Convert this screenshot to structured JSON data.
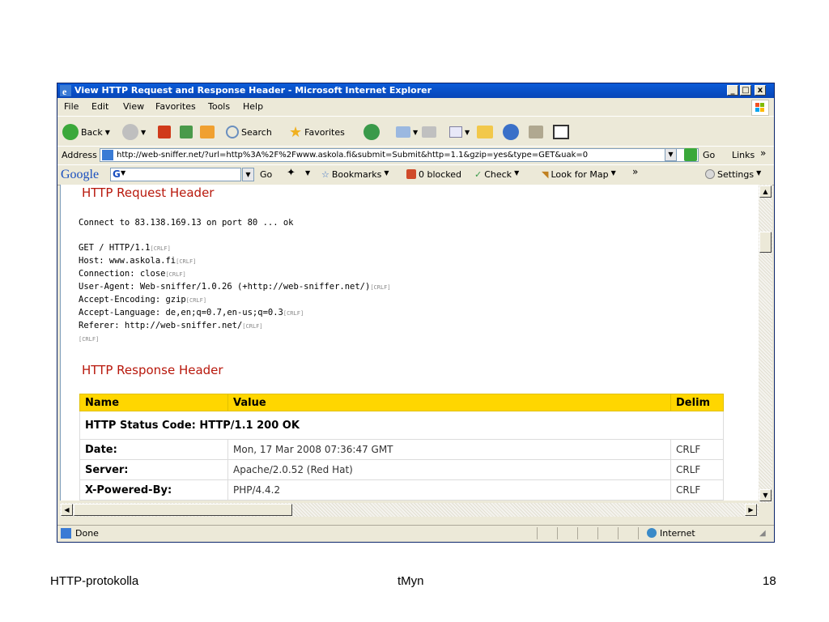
{
  "window": {
    "title": "View HTTP Request and Response Header - Microsoft Internet Explorer",
    "min_glyph": "_",
    "max_glyph": "□",
    "close_glyph": "x"
  },
  "menu": [
    "File",
    "Edit",
    "View",
    "Favorites",
    "Tools",
    "Help"
  ],
  "toolbar": {
    "back": "Back",
    "search": "Search",
    "favorites": "Favorites"
  },
  "address": {
    "label": "Address",
    "url": "http://web-sniffer.net/?url=http%3A%2F%2Fwww.askola.fi&submit=Submit&http=1.1&gzip=yes&type=GET&uak=0",
    "go": "Go",
    "links": "Links"
  },
  "google": {
    "logo": "Google",
    "go": "Go",
    "bookmarks": "Bookmarks",
    "blocked": "0 blocked",
    "check": "Check",
    "lookfor": "Look for Map",
    "settings": "Settings"
  },
  "request": {
    "title": "HTTP Request Header",
    "connect": "Connect to 83.138.169.13 on port 80 ... ok",
    "lines": [
      "GET / HTTP/1.1",
      "Host: www.askola.fi",
      "Connection: close",
      "User-Agent: Web-sniffer/1.0.26 (+http://web-sniffer.net/)",
      "Accept-Encoding: gzip",
      "Accept-Language: de,en;q=0.7,en-us;q=0.3",
      "Referer: http://web-sniffer.net/"
    ],
    "crlf": "[CRLF]"
  },
  "response": {
    "title": "HTTP Response Header",
    "headers": [
      "Name",
      "Value",
      "Delim"
    ],
    "status": "HTTP Status Code: HTTP/1.1 200 OK",
    "rows": [
      {
        "name": "Date:",
        "value": "Mon, 17 Mar 2008 07:36:47 GMT",
        "delim": "CRLF"
      },
      {
        "name": "Server:",
        "value": "Apache/2.0.52 (Red Hat)",
        "delim": "CRLF"
      },
      {
        "name": "X-Powered-By:",
        "value": "PHP/4.4.2",
        "delim": "CRLF"
      }
    ]
  },
  "status": {
    "done": "Done",
    "zone": "Internet"
  },
  "footer": {
    "left": "HTTP-protokolla",
    "center": "tMyn",
    "right": "18"
  }
}
